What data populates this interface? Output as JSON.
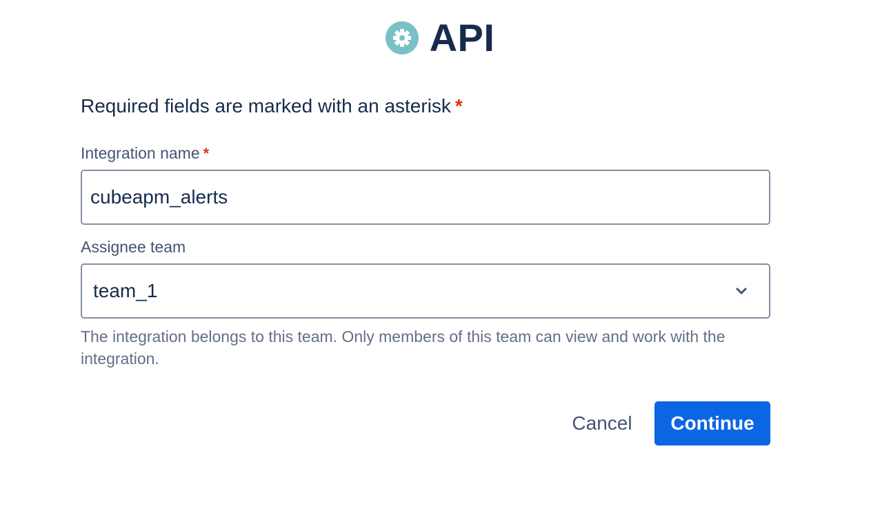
{
  "header": {
    "title": "API",
    "icon": "gear-icon",
    "icon_color": "#79c1c4"
  },
  "form": {
    "required_note": "Required fields are marked with an asterisk",
    "required_marker": "*",
    "integration_name": {
      "label": "Integration name",
      "value": "cubeapm_alerts"
    },
    "assignee_team": {
      "label": "Assignee team",
      "selected": "team_1",
      "helper": "The integration belongs to this team. Only members of this team can view and work with the integration."
    }
  },
  "actions": {
    "cancel_label": "Cancel",
    "continue_label": "Continue",
    "primary_color": "#0c66e4"
  }
}
